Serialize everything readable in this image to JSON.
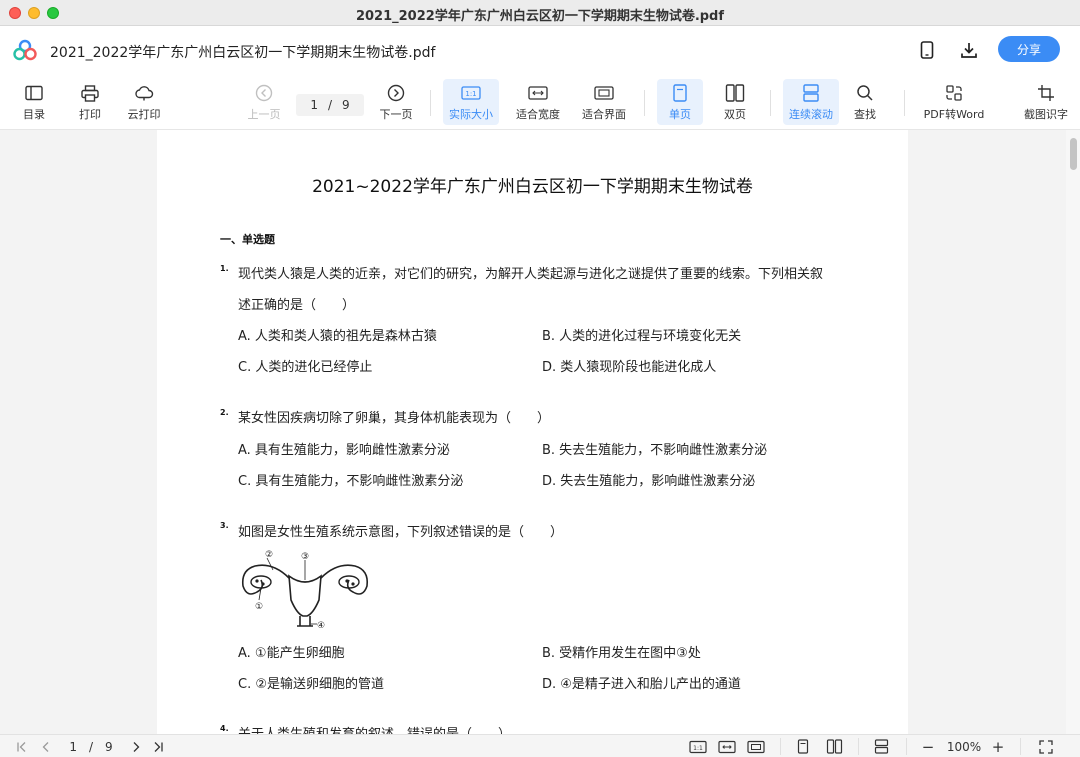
{
  "window": {
    "title": "2021_2022学年广东广州白云区初一下学期期末生物试卷.pdf"
  },
  "header": {
    "doc_name": "2021_2022学年广东广州白云区初一下学期期末生物试卷.pdf",
    "share_label": "分享",
    "icons": [
      "phone-icon",
      "download-icon"
    ]
  },
  "toolbar": {
    "toc": "目录",
    "print": "打印",
    "cloud_print": "云打印",
    "prev_page": "上一页",
    "current_page": "1",
    "page_sep": "/",
    "total_pages": "9",
    "next_page": "下一页",
    "actual_size": "实际大小",
    "actual_size_icon_text": "1:1",
    "fit_width": "适合宽度",
    "fit_page": "适合界面",
    "single_page": "单页",
    "double_page": "双页",
    "continuous_scroll": "连续滚动",
    "find": "查找",
    "pdf_to_word": "PDF转Word",
    "ocr": "截图识字"
  },
  "document": {
    "title": "2021~2022学年广东广州白云区初一下学期期末生物试卷",
    "section": "一、单选题",
    "questions": [
      {
        "num": "1.",
        "lines": [
          "现代类人猿是人类的近亲，对它们的研究，为解开人类起源与进化之谜提供了重要的线索。下列相关叙",
          "述正确的是（　　）"
        ],
        "options": [
          "A. 人类和类人猿的祖先是森林古猿",
          "B. 人类的进化过程与环境变化无关",
          "C. 人类的进化已经停止",
          "D. 类人猿现阶段也能进化成人"
        ]
      },
      {
        "num": "2.",
        "lines": [
          "某女性因疾病切除了卵巢，其身体机能表现为（　　）"
        ],
        "options": [
          "A. 具有生殖能力，影响雌性激素分泌",
          "B. 失去生殖能力，不影响雌性激素分泌",
          "C. 具有生殖能力，不影响雌性激素分泌",
          "D. 失去生殖能力，影响雌性激素分泌"
        ]
      },
      {
        "num": "3.",
        "lines": [
          "如图是女性生殖系统示意图，下列叙述错误的是（　　）"
        ],
        "figure_labels": [
          "①",
          "②",
          "③",
          "④"
        ],
        "options": [
          "A. ①能产生卵细胞",
          "B. 受精作用发生在图中③处",
          "C. ②是输送卵细胞的管道",
          "D. ④是精子进入和胎儿产出的通道"
        ]
      },
      {
        "num": "4.",
        "lines": [
          "关于人类生殖和发育的叙述，错误的是（　　）"
        ]
      }
    ]
  },
  "statusbar": {
    "current_page": "1",
    "page_sep": "/",
    "total_pages": "9",
    "actual_size_icon_text": "1:1",
    "zoom": "100%",
    "minus": "−",
    "plus": "+"
  },
  "colors": {
    "accent": "#3b8cf5",
    "active_bg": "#e8f1fd"
  }
}
